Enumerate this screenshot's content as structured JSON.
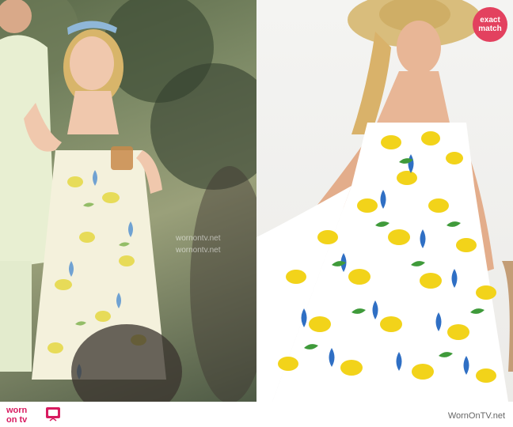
{
  "badge": {
    "line1": "exact",
    "line2": "match"
  },
  "watermarks": [
    "wornontv.net",
    "wornontv.net",
    "wornontv.net"
  ],
  "footer": {
    "logo_top": "worn",
    "logo_bottom": "on tv",
    "credit": "WornOnTV.net"
  },
  "colors": {
    "brand": "#d81b60",
    "badge": "#e3415f"
  }
}
